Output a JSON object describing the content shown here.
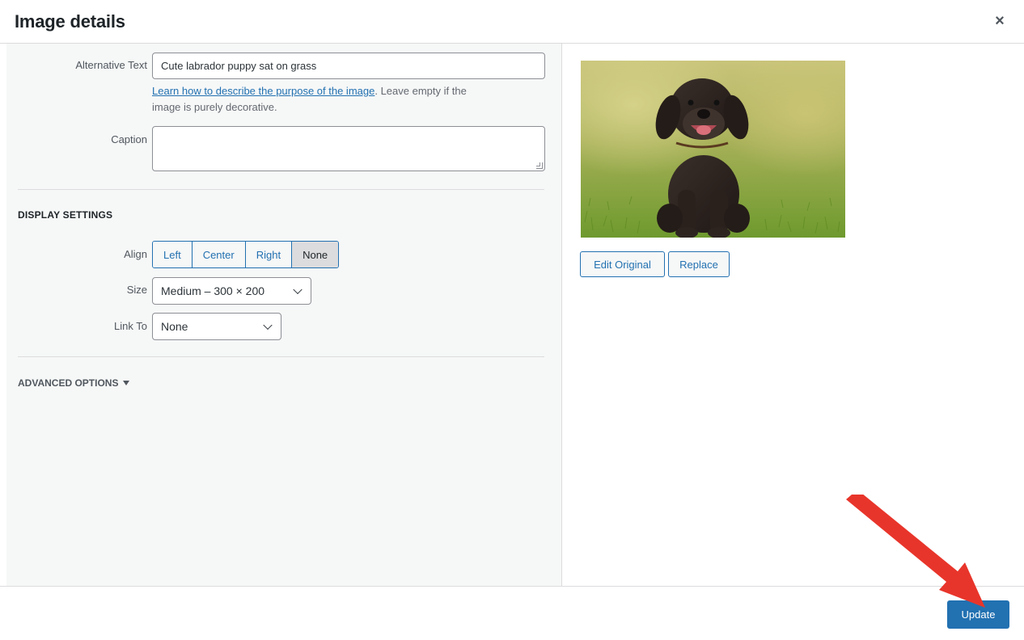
{
  "modal": {
    "title": "Image details",
    "close_symbol": "×"
  },
  "fields": {
    "alt_text": {
      "label": "Alternative Text",
      "value": "Cute labrador puppy sat on grass",
      "help_link": "Learn how to describe the purpose of the image",
      "help_rest_line1": ". Leave empty if the",
      "help_rest_line2": "image is purely decorative."
    },
    "caption": {
      "label": "Caption",
      "value": ""
    }
  },
  "display_settings": {
    "title": "DISPLAY SETTINGS",
    "align": {
      "label": "Align",
      "options": [
        "Left",
        "Center",
        "Right",
        "None"
      ],
      "selected": "None"
    },
    "size": {
      "label": "Size",
      "value": "Medium – 300 × 200"
    },
    "link_to": {
      "label": "Link To",
      "value": "None"
    }
  },
  "advanced": {
    "label": "ADVANCED OPTIONS"
  },
  "preview": {
    "edit_original_label": "Edit Original",
    "replace_label": "Replace"
  },
  "footer": {
    "update_label": "Update"
  },
  "colors": {
    "accent": "#2271b1",
    "annotation_arrow": "#e8352b"
  },
  "icons": {
    "close": "close-icon",
    "dropdown": "chevron-down-icon",
    "disclosure": "triangle-down-icon"
  }
}
